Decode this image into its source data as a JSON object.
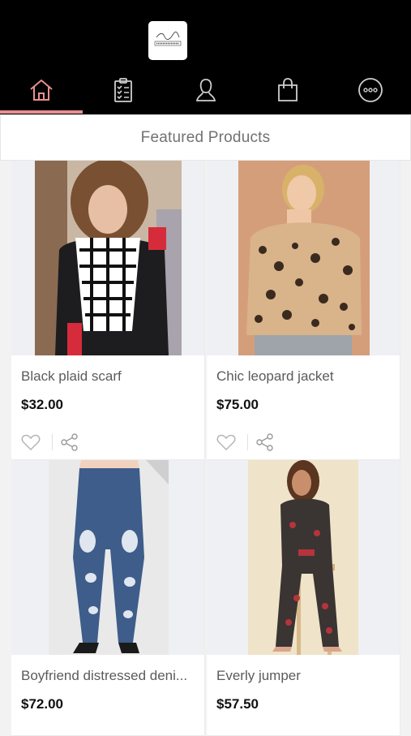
{
  "brand": {
    "logo_text": "Beautiful Boutique"
  },
  "nav": {
    "items": [
      {
        "name": "home",
        "icon": "home-icon",
        "active": true
      },
      {
        "name": "orders",
        "icon": "clipboard-icon",
        "active": false
      },
      {
        "name": "account",
        "icon": "user-icon",
        "active": false
      },
      {
        "name": "cart",
        "icon": "shopping-bag-icon",
        "active": false
      },
      {
        "name": "more",
        "icon": "more-icon",
        "active": false
      }
    ]
  },
  "colors": {
    "accent": "#e78f8f",
    "header_bg": "#000000",
    "icon_inactive": "#cfcfcf"
  },
  "section": {
    "title": "Featured Products"
  },
  "products": [
    {
      "name": "Black plaid scarf",
      "price": "$32.00"
    },
    {
      "name": "Chic leopard jacket",
      "price": "$75.00"
    },
    {
      "name": "Boyfriend distressed deni...",
      "price": "$72.00"
    },
    {
      "name": "Everly jumper",
      "price": "$57.50"
    }
  ]
}
